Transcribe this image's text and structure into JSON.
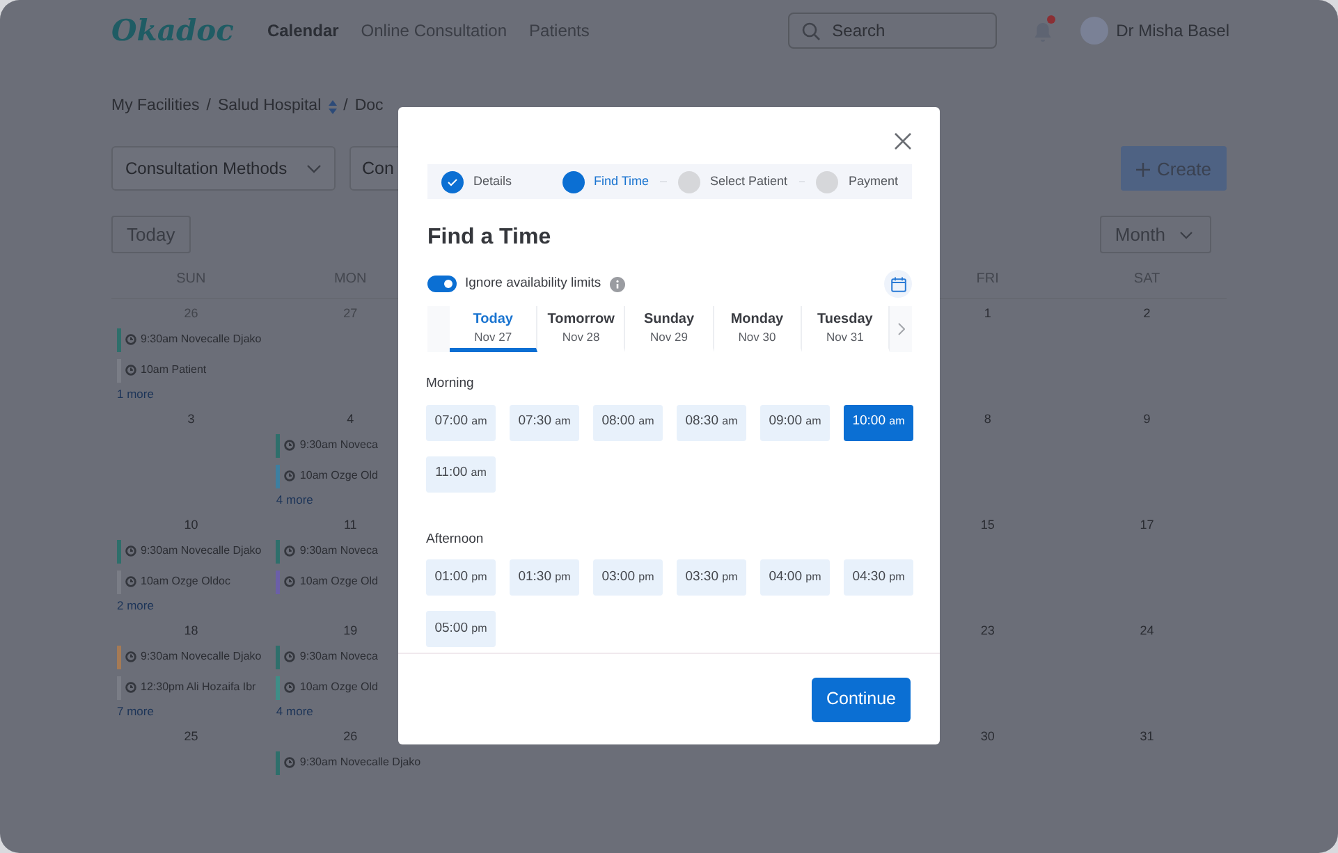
{
  "header": {
    "logo": "Okadoc",
    "nav": [
      {
        "label": "Calendar",
        "selected": true
      },
      {
        "label": "Online Consultation",
        "selected": false
      },
      {
        "label": "Patients",
        "selected": false
      }
    ],
    "search": {
      "placeholder": "Search"
    },
    "has_notification": true,
    "user": "Dr Misha Basel"
  },
  "breadcrumb": [
    {
      "kind": "link",
      "label": "My Facilities",
      "dropdown": false
    },
    {
      "kind": "separator",
      "label": "/"
    },
    {
      "kind": "link",
      "label": "Salud Hospital",
      "dropdown": true
    },
    {
      "kind": "separator",
      "label": "/"
    },
    {
      "kind": "link",
      "label": "Doc",
      "dropdown": false
    }
  ],
  "filters": [
    "Consultation Methods",
    "Con"
  ],
  "create_button": "Create",
  "today_button": "Today",
  "view_select": "Month",
  "calendar": {
    "columns": [
      "SUN",
      "MON",
      "FRI",
      "SAT"
    ],
    "weeks": [
      {
        "cells": [
          {
            "date": "26",
            "muted": true,
            "events": [
              {
                "text": "9:30am Novecalle Djako",
                "color": "#2e6f6b"
              },
              {
                "text": "10am Patient",
                "color": "#7a7d86"
              }
            ],
            "more": "1 more"
          },
          {
            "date": "27",
            "muted": true
          },
          {
            "date": "1",
            "muted": false
          },
          {
            "date": "2",
            "muted": false
          }
        ]
      },
      {
        "cells": [
          {
            "date": "3",
            "muted": false
          },
          {
            "date": "4",
            "muted": false,
            "events": [
              {
                "text": "9:30am Noveca",
                "color": "#2e6f6b"
              },
              {
                "text": "10am Ozge Old",
                "color": "#3d7fa1"
              }
            ],
            "more": "4 more"
          },
          {
            "date": "8",
            "muted": false
          },
          {
            "date": "9",
            "muted": false
          }
        ]
      },
      {
        "cells": [
          {
            "date": "10",
            "muted": false,
            "events": [
              {
                "text": "9:30am Novecalle Djako",
                "color": "#2e6f6b"
              },
              {
                "text": "10am Ozge Oldoc",
                "color": "#7a7d86"
              }
            ],
            "more": "2 more"
          },
          {
            "date": "11",
            "muted": false,
            "events": [
              {
                "text": "9:30am Noveca",
                "color": "#2e6f6b"
              },
              {
                "text": "10am Ozge Old",
                "color": "#6b5fa8"
              }
            ]
          },
          {
            "date": "15",
            "muted": false
          },
          {
            "date": "17",
            "muted": false
          }
        ]
      },
      {
        "cells": [
          {
            "date": "18",
            "muted": false,
            "events": [
              {
                "text": "9:30am Novecalle Djako",
                "color": "#a57a55"
              },
              {
                "text": "12:30pm Ali Hozaifa Ibr",
                "color": "#7a7d86"
              }
            ],
            "more": "7 more"
          },
          {
            "date": "19",
            "muted": false,
            "events": [
              {
                "text": "9:30am Noveca",
                "color": "#2e6f6b"
              },
              {
                "text": "10am Ozge Old",
                "color": "#3e8e87"
              }
            ],
            "more": "4 more"
          },
          {
            "date": "23",
            "muted": false
          },
          {
            "date": "24",
            "muted": false
          }
        ]
      },
      {
        "cells": [
          {
            "date": "25",
            "muted": false
          },
          {
            "date": "26",
            "muted": false,
            "events": [
              {
                "text": "9:30am Novecalle Djako",
                "color": "#2e6f6b"
              }
            ]
          },
          {
            "date": "30",
            "muted": false
          },
          {
            "date": "31",
            "muted": false
          }
        ]
      }
    ]
  },
  "modal": {
    "steps": [
      {
        "label": "Details",
        "completed": true,
        "selected": false
      },
      {
        "label": "Find Time",
        "completed": false,
        "selected": true
      },
      {
        "label": "Select Patient",
        "completed": false,
        "selected": false
      },
      {
        "label": "Payment",
        "completed": false,
        "selected": false
      }
    ],
    "title": "Find a Time",
    "toggle": {
      "label": "Ignore availability limits",
      "on": true
    },
    "days": [
      {
        "day": "Today",
        "date": "Nov 27",
        "selected": true
      },
      {
        "day": "Tomorrow",
        "date": "Nov 28",
        "selected": false
      },
      {
        "day": "Sunday",
        "date": "Nov 29",
        "selected": false
      },
      {
        "day": "Monday",
        "date": "Nov 30",
        "selected": false
      },
      {
        "day": "Tuesday",
        "date": "Nov 31",
        "selected": false
      }
    ],
    "sections": [
      {
        "title": "Morning",
        "slots": [
          {
            "time": "07:00",
            "period": "am",
            "selected": false
          },
          {
            "time": "07:30",
            "period": "am",
            "selected": false
          },
          {
            "time": "08:00",
            "period": "am",
            "selected": false
          },
          {
            "time": "08:30",
            "period": "am",
            "selected": false
          },
          {
            "time": "09:00",
            "period": "am",
            "selected": false
          },
          {
            "time": "10:00",
            "period": "am",
            "selected": true
          },
          {
            "time": "11:00",
            "period": "am",
            "selected": false
          }
        ]
      },
      {
        "title": "Afternoon",
        "slots": [
          {
            "time": "01:00",
            "period": "pm",
            "selected": false
          },
          {
            "time": "01:30",
            "period": "pm",
            "selected": false
          },
          {
            "time": "03:00",
            "period": "pm",
            "selected": false
          },
          {
            "time": "03:30",
            "period": "pm",
            "selected": false
          },
          {
            "time": "04:00",
            "period": "pm",
            "selected": false
          },
          {
            "time": "04:30",
            "period": "pm",
            "selected": false
          },
          {
            "time": "05:00",
            "period": "pm",
            "selected": false
          }
        ]
      }
    ],
    "continue_button": "Continue"
  }
}
